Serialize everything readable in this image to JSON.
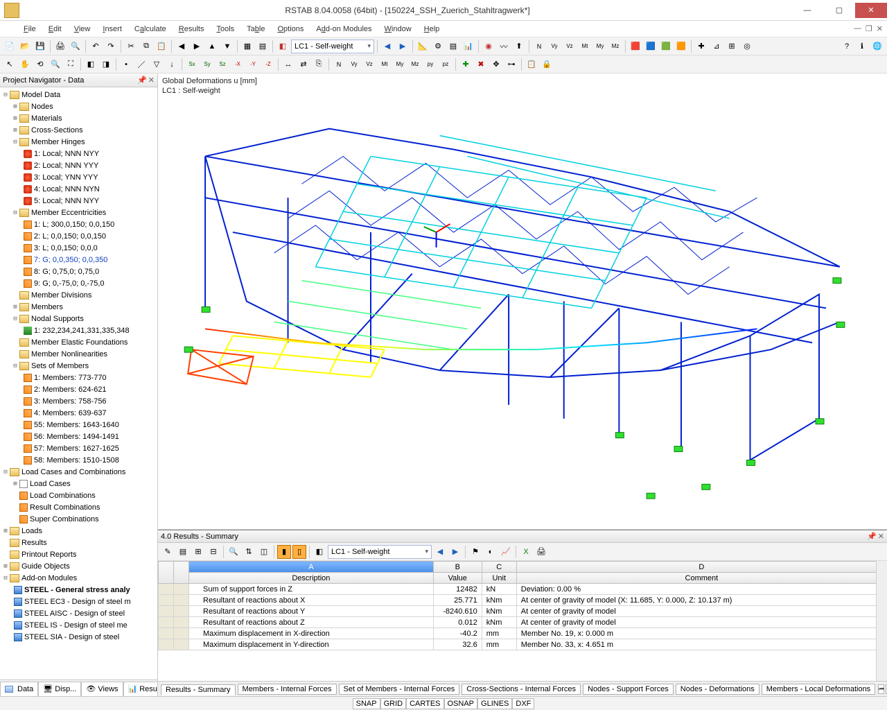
{
  "window": {
    "title": "RSTAB 8.04.0058 (64bit) - [150224_SSH_Zuerich_Stahltragwerk*]"
  },
  "menu": [
    "File",
    "Edit",
    "View",
    "Insert",
    "Calculate",
    "Results",
    "Tools",
    "Table",
    "Options",
    "Add-on Modules",
    "Window",
    "Help"
  ],
  "loadcase_combo": "LC1 - Self-weight",
  "navigator": {
    "title": "Project Navigator - Data",
    "tree": {
      "model_data": "Model Data",
      "nodes": "Nodes",
      "materials": "Materials",
      "cross_sections": "Cross-Sections",
      "member_hinges": "Member Hinges",
      "hinges": [
        "1: Local; NNN NYY",
        "2: Local; NNN YYY",
        "3: Local; YNN YYY",
        "4: Local; NNN NYN",
        "5: Local; NNN NYY"
      ],
      "member_ecc": "Member Eccentricities",
      "ecc": [
        "1: L; 300,0,150; 0,0,150",
        "2: L; 0,0,150; 0,0,150",
        "3: L; 0,0,150; 0,0,0",
        "7: G; 0,0,350; 0,0,350",
        "8: G; 0,75,0; 0,75,0",
        "9: G; 0,-75,0; 0,-75,0"
      ],
      "member_div": "Member Divisions",
      "members": "Members",
      "nodal_sup": "Nodal Supports",
      "nodal_sup_1": "1: 232,234,241,331,335,348",
      "elastic_found": "Member Elastic Foundations",
      "nonlin": "Member Nonlinearities",
      "sets": "Sets of Members",
      "set_items": [
        "1: Members: 773-770",
        "2: Members: 624-621",
        "3: Members: 758-756",
        "4: Members: 639-637",
        "55: Members: 1643-1640",
        "56: Members: 1494-1491",
        "57: Members: 1627-1625",
        "58: Members: 1510-1508"
      ],
      "lc_comb": "Load Cases and Combinations",
      "lc": "Load Cases",
      "lcomb": "Load Combinations",
      "rcomb": "Result Combinations",
      "scomb": "Super Combinations",
      "loads": "Loads",
      "results": "Results",
      "printout": "Printout Reports",
      "guide": "Guide Objects",
      "addon": "Add-on Modules",
      "addon_items": [
        "STEEL - General stress analy",
        "STEEL EC3 - Design of steel m",
        "STEEL AISC - Design of steel",
        "STEEL IS - Design of steel me",
        "STEEL SIA - Design of steel"
      ]
    },
    "tabs": [
      "Data",
      "Disp...",
      "Views",
      "Resu..."
    ]
  },
  "viewport": {
    "line1": "Global Deformations u [mm]",
    "line2": "LC1 : Self-weight"
  },
  "results_panel": {
    "title": "4.0 Results - Summary",
    "loadcase": "LC1 - Self-weight",
    "columns": {
      "a": "Description",
      "b": "Value",
      "c": "Unit",
      "d": "Comment",
      "al": "A",
      "bl": "B",
      "cl": "C",
      "dl": "D"
    },
    "rows": [
      {
        "desc": "Sum of support forces in Z",
        "val": "12482",
        "unit": "kN",
        "comment": "Deviation:  0.00 %"
      },
      {
        "desc": "Resultant of reactions about X",
        "val": "25.771",
        "unit": "kNm",
        "comment": "At center of gravity of model (X: 11.685, Y: 0.000, Z: 10.137 m)"
      },
      {
        "desc": "Resultant of reactions about Y",
        "val": "-8240.610",
        "unit": "kNm",
        "comment": "At center of gravity of model"
      },
      {
        "desc": "Resultant of reactions about Z",
        "val": "0.012",
        "unit": "kNm",
        "comment": "At center of gravity of model"
      },
      {
        "desc": "Maximum displacement in X-direction",
        "val": "-40.2",
        "unit": "mm",
        "comment": "Member No. 19,  x: 0.000 m"
      },
      {
        "desc": "Maximum displacement in Y-direction",
        "val": "32.6",
        "unit": "mm",
        "comment": "Member No. 33,  x: 4.651 m"
      }
    ],
    "tabs": [
      "Results - Summary",
      "Members - Internal Forces",
      "Set of Members - Internal Forces",
      "Cross-Sections - Internal Forces",
      "Nodes - Support Forces",
      "Nodes - Deformations",
      "Members - Local Deformations"
    ]
  },
  "statusbar": [
    "SNAP",
    "GRID",
    "CARTES",
    "OSNAP",
    "GLINES",
    "DXF"
  ]
}
